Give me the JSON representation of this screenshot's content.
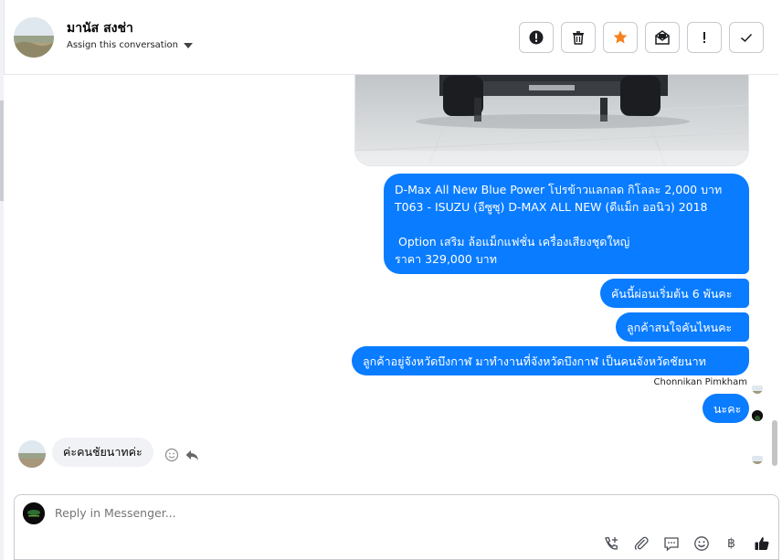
{
  "header": {
    "contact_name": "มานัส สงช่า",
    "assign_label": "Assign this conversation",
    "actions": [
      {
        "name": "spam-button",
        "icon": "exclamation-circle-icon"
      },
      {
        "name": "delete-button",
        "icon": "trash-icon"
      },
      {
        "name": "star-button",
        "icon": "star-icon",
        "color": "#f5811f"
      },
      {
        "name": "mark-unread-button",
        "icon": "envelope-icon"
      },
      {
        "name": "follow-up-button",
        "icon": "exclamation-icon"
      },
      {
        "name": "mark-done-button",
        "icon": "check-icon"
      }
    ]
  },
  "messages": {
    "outgoing": [
      {
        "text": "D-Max All New Blue Power โปรข้าวแลกลด กิโลละ 2,000 บาท\nT063 - ISUZU (อีซูซุ) D-MAX ALL NEW (ดีแม็ก ออนิว) 2018\n\n Option เสริม ล้อแม็กแฟชั่น เครื่องเสียงชุดใหญ่\nราคา 329,000 บาท"
      },
      {
        "text": "คันนี้ผ่อนเริ่มต้น 6 พันคะ"
      },
      {
        "text": "ลูกค้าสนใจคันไหนคะ"
      },
      {
        "text": "ลูกค้าอยู่จังหวัดบึงกาฬ มาทำงานที่จังหวัดบึงกาฬ เป็นคนจังหวัดชัยนาท"
      },
      {
        "text": "นะคะ"
      }
    ],
    "sender_name": "Chonnikan Pimkham",
    "incoming": [
      {
        "text": "ค่ะคนชัยนาทค่ะ"
      }
    ]
  },
  "composer": {
    "placeholder": "Reply in Messenger...",
    "tools": [
      "add-call-icon",
      "paperclip-icon",
      "saved-reply-icon",
      "emoji-icon",
      "baht-icon",
      "thumbs-up-icon"
    ],
    "baht_symbol": "฿"
  },
  "colors": {
    "outgoing_bubble": "#0a7cff",
    "incoming_bubble": "#f0f2f5",
    "accent_star": "#f5811f"
  }
}
